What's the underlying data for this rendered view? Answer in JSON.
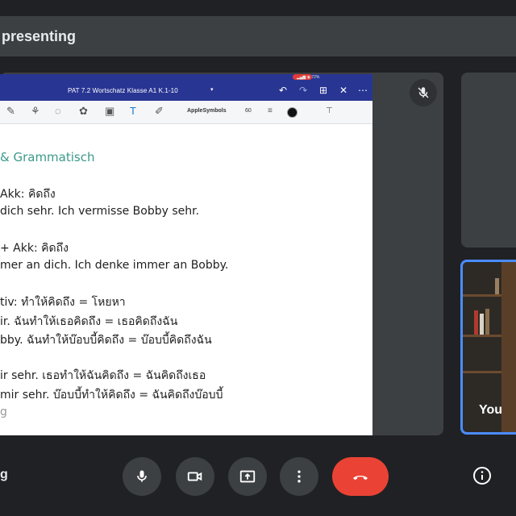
{
  "presenting_bar": {
    "text": "presenting"
  },
  "document": {
    "title": "PAT 7.2 Wortschatz Klasse A1 K.1-10",
    "status_battery": "72%",
    "font_name": "AppleSymbols",
    "font_size": "60",
    "lines": [
      "& Grammatisch",
      "Akk: คิดถึง",
      "dich sehr. Ich vermisse Bobby sehr.",
      "+ Akk: คิดถึง",
      "mer an dich. Ich denke immer an Bobby.",
      "tiv: ทำให้คิดถึง = โหยหา",
      "ir. ฉันทำให้เธอคิดถึง = เธอคิดถึงฉัน",
      "bby. ฉันทำให้บ๊อบบี้คิดถึง = บ๊อบบี้คิดถึงฉัน",
      "ir sehr. เธอทำให้ฉันคิดถึง = ฉันคิดถึงเธอ",
      "mir sehr. บ๊อบบี้ทำให้คิดถึง = ฉันคิดถึงบ๊อบบี้",
      "g"
    ]
  },
  "self_view": {
    "label": "You"
  },
  "meeting_name": "g",
  "controls": {
    "mic": "microphone-icon",
    "camera": "camera-icon",
    "present": "present-screen-icon",
    "more": "more-options-icon",
    "end": "end-call-icon",
    "info": "info-icon"
  },
  "colors": {
    "end_call": "#ea4335",
    "self_border": "#4a8cff",
    "doc_header": "#283593"
  }
}
